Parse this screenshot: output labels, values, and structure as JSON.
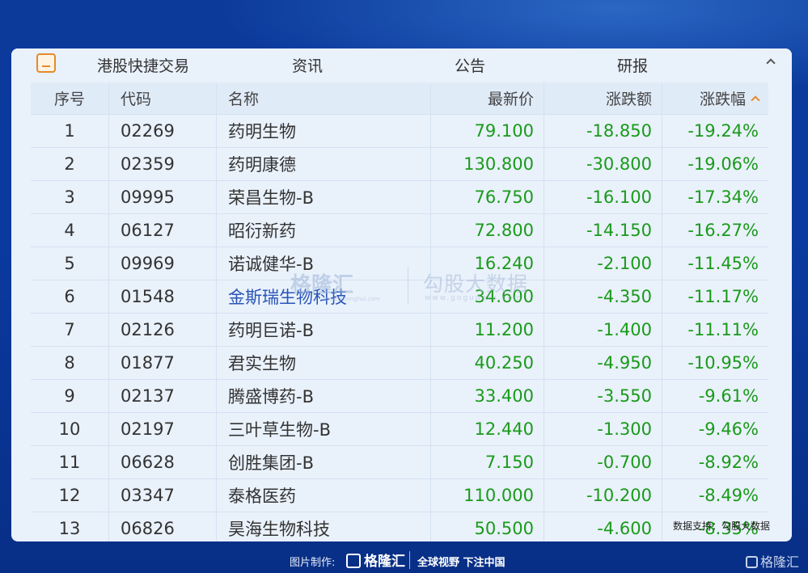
{
  "tabs": {
    "hk_quick_trade": "港股快捷交易",
    "news": "资讯",
    "announcements": "公告",
    "research": "研报"
  },
  "table": {
    "headers": {
      "index": "序号",
      "code": "代码",
      "name": "名称",
      "price": "最新价",
      "change": "涨跌额",
      "change_pct": "涨跌幅"
    },
    "sort": {
      "column": "涨跌幅",
      "direction": "ascending"
    },
    "rows": [
      {
        "index": "1",
        "code": "02269",
        "name": "药明生物",
        "price": "79.100",
        "change": "-18.850",
        "change_pct": "-19.24%"
      },
      {
        "index": "2",
        "code": "02359",
        "name": "药明康德",
        "price": "130.800",
        "change": "-30.800",
        "change_pct": "-19.06%"
      },
      {
        "index": "3",
        "code": "09995",
        "name": "荣昌生物-B",
        "price": "76.750",
        "change": "-16.100",
        "change_pct": "-17.34%"
      },
      {
        "index": "4",
        "code": "06127",
        "name": "昭衍新药",
        "price": "72.800",
        "change": "-14.150",
        "change_pct": "-16.27%"
      },
      {
        "index": "5",
        "code": "09969",
        "name": "诺诚健华-B",
        "price": "16.240",
        "change": "-2.100",
        "change_pct": "-11.45%"
      },
      {
        "index": "6",
        "code": "01548",
        "name": "金斯瑞生物科技",
        "price": "34.600",
        "change": "-4.350",
        "change_pct": "-11.17%"
      },
      {
        "index": "7",
        "code": "02126",
        "name": "药明巨诺-B",
        "price": "11.200",
        "change": "-1.400",
        "change_pct": "-11.11%"
      },
      {
        "index": "8",
        "code": "01877",
        "name": "君实生物",
        "price": "40.250",
        "change": "-4.950",
        "change_pct": "-10.95%"
      },
      {
        "index": "9",
        "code": "02137",
        "name": "腾盛博药-B",
        "price": "33.400",
        "change": "-3.550",
        "change_pct": "-9.61%"
      },
      {
        "index": "10",
        "code": "02197",
        "name": "三叶草生物-B",
        "price": "12.440",
        "change": "-1.300",
        "change_pct": "-9.46%"
      },
      {
        "index": "11",
        "code": "06628",
        "name": "创胜集团-B",
        "price": "7.150",
        "change": "-0.700",
        "change_pct": "-8.92%"
      },
      {
        "index": "12",
        "code": "03347",
        "name": "泰格医药",
        "price": "110.000",
        "change": "-10.200",
        "change_pct": "-8.49%"
      },
      {
        "index": "13",
        "code": "06826",
        "name": "昊海生物科技",
        "price": "50.500",
        "change": "-4.600",
        "change_pct": "-8.35%"
      }
    ]
  },
  "watermark": {
    "left_brand": "格隆汇",
    "left_url": "www.gelonghui.com",
    "right_brand": "勾股大数据",
    "right_url": "www.gogudata.com"
  },
  "data_support": "数据支持：勾股大数据",
  "footer": {
    "made_by": "图片制作:",
    "brand": "格隆汇",
    "slogan": "全球视野 下注中国",
    "corner_brand": "格隆汇"
  },
  "colors": {
    "negative": "#1a9a1a",
    "accent": "#e58a2a",
    "link": "#2a55b8",
    "background": "#0b3a9a"
  },
  "icons": {
    "tab_icon": "minimize-window-icon",
    "collapse": "chevron-up-icon",
    "sort": "sort-ascending-icon"
  }
}
